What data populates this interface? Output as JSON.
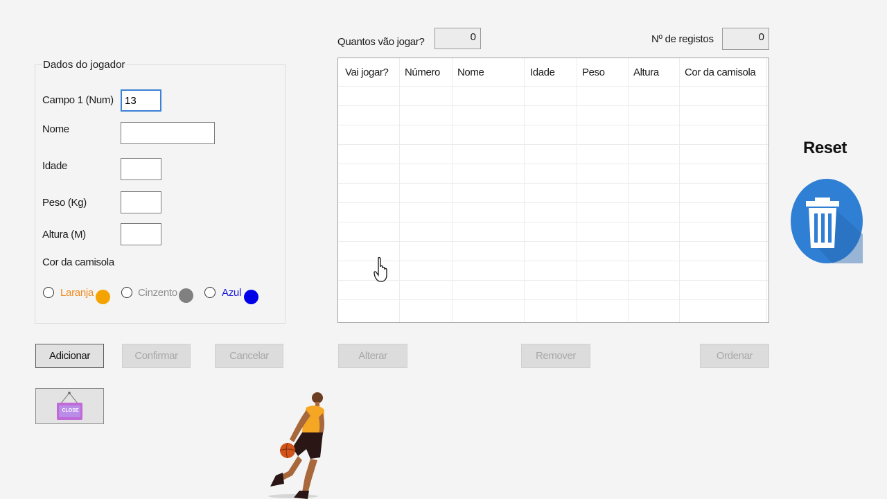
{
  "group": {
    "title": "Dados do jogador"
  },
  "form": {
    "campo1_label": "Campo 1 (Num)",
    "campo1_value": "13",
    "nome_label": "Nome",
    "nome_value": "",
    "idade_label": "Idade",
    "idade_value": "",
    "peso_label": "Peso (Kg)",
    "peso_value": "",
    "altura_label": "Altura (M)",
    "altura_value": "",
    "cor_label": "Cor da camisola"
  },
  "colors": [
    {
      "label": "Laranja",
      "text_color": "#f08a1c",
      "dot_color": "#f5a300"
    },
    {
      "label": "Cinzento",
      "text_color": "#8c8c8c",
      "dot_color": "#808080"
    },
    {
      "label": "Azul",
      "text_color": "#1a1adc",
      "dot_color": "#0000e8"
    }
  ],
  "counters": {
    "quantos_label": "Quantos vão jogar?",
    "quantos_value": "0",
    "registos_label": "Nº de registos",
    "registos_value": "0"
  },
  "grid": {
    "columns": [
      "Vai jogar?",
      "Número",
      "Nome",
      "Idade",
      "Peso",
      "Altura",
      "Cor da camisola"
    ],
    "rows": []
  },
  "buttons": {
    "adicionar": "Adicionar",
    "confirmar": "Confirmar",
    "cancelar": "Cancelar",
    "alterar": "Alterar",
    "remover": "Remover",
    "ordenar": "Ordenar"
  },
  "reset": {
    "label": "Reset",
    "icon": "trash-icon",
    "color": "#2f7fd4"
  },
  "close": {
    "sign_text": "CLOSE",
    "sign_color": "#c06ad8"
  },
  "illustration": {
    "icon": "basketball-player-icon"
  }
}
